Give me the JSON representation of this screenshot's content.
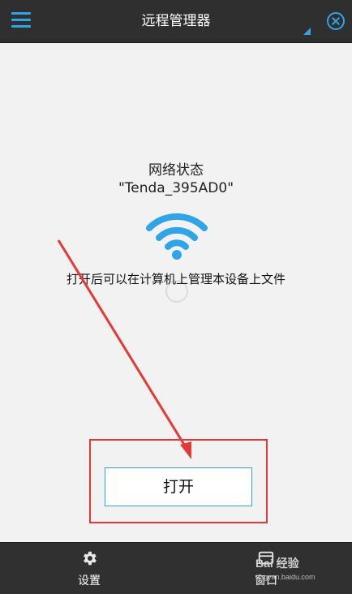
{
  "header": {
    "title": "远程管理器",
    "menu_icon": "hamburger-menu-icon",
    "close_icon": "close-circle-icon"
  },
  "main": {
    "status_label": "网络状态",
    "ssid": "\"Tenda_395AD0\"",
    "wifi_icon": "wifi-icon",
    "description": "打开后可以在计算机上管理本设备上文件",
    "open_button_label": "打开"
  },
  "bottom_nav": {
    "settings_label": "设置",
    "settings_icon": "gear-icon",
    "window_label": "窗口",
    "window_icon": "window-icon"
  },
  "watermark": {
    "text": "Bai 经验",
    "sub": "jingyan.baidu.com"
  },
  "colors": {
    "accent": "#2fa4e7",
    "annotation": "#e53935",
    "bar": "#2f2f2f"
  }
}
